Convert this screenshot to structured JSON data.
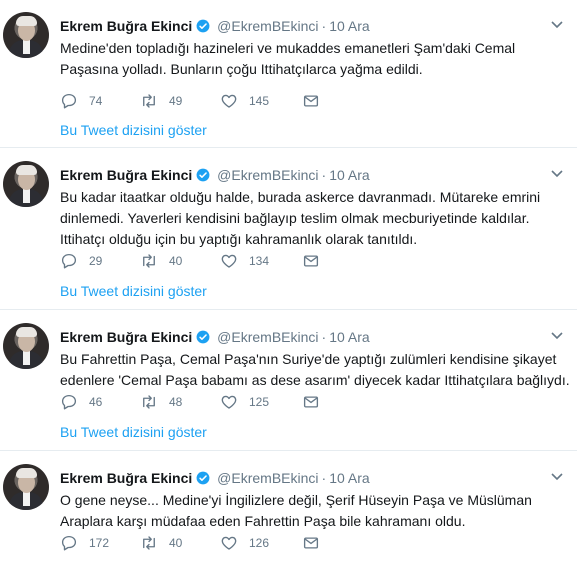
{
  "colors": {
    "accent": "#1da1f2",
    "muted": "#657786",
    "text": "#14171a",
    "divider": "#e6ecf0"
  },
  "tweets": [
    {
      "name": "Ekrem Buğra Ekinci",
      "handle": "@EkremBEkinci",
      "separator": "·",
      "time": "10 Ara",
      "lines": [
        "Medine'den topladığı hazineleri ve mukaddes emanetleri Şam'daki Cemal",
        "Paşasına yolladı. Bunların çoğu Ittihatçılarca yağma edildi."
      ],
      "replies": "74",
      "retweets": "49",
      "likes": "145",
      "thread_link": "Bu Tweet dizisini göster"
    },
    {
      "name": "Ekrem Buğra Ekinci",
      "handle": "@EkremBEkinci",
      "separator": "·",
      "time": "10 Ara",
      "lines": [
        "Bu kadar itaatkar olduğu halde, burada askerce davranmadı. Mütareke emrini",
        "dinlemedi. Yaverleri kendisini bağlayıp teslim olmak mecburiyetinde kaldılar.",
        "Ittihatçı olduğu için bu yaptığı kahramanlık olarak tanıtıldı."
      ],
      "replies": "29",
      "retweets": "40",
      "likes": "134",
      "thread_link": "Bu Tweet dizisini göster"
    },
    {
      "name": "Ekrem Buğra Ekinci",
      "handle": "@EkremBEkinci",
      "separator": "·",
      "time": "10 Ara",
      "lines": [
        "Bu Fahrettin Paşa, Cemal Paşa'nın Suriye'de yaptığı zulümleri kendisine şikayet",
        "edenlere 'Cemal Paşa babamı as dese asarım' diyecek kadar Ittihatçılara bağlıydı."
      ],
      "replies": "46",
      "retweets": "48",
      "likes": "125",
      "thread_link": "Bu Tweet dizisini göster"
    },
    {
      "name": "Ekrem Buğra Ekinci",
      "handle": "@EkremBEkinci",
      "separator": "·",
      "time": "10 Ara",
      "lines": [
        "O gene neyse... Medine'yi İngilizlere değil, Şerif Hüseyin Paşa ve Müslüman",
        "Araplara karşı müdafaa eden Fahrettin Paşa bile kahramanı oldu."
      ],
      "replies": "172",
      "retweets": "40",
      "likes": "126"
    }
  ]
}
